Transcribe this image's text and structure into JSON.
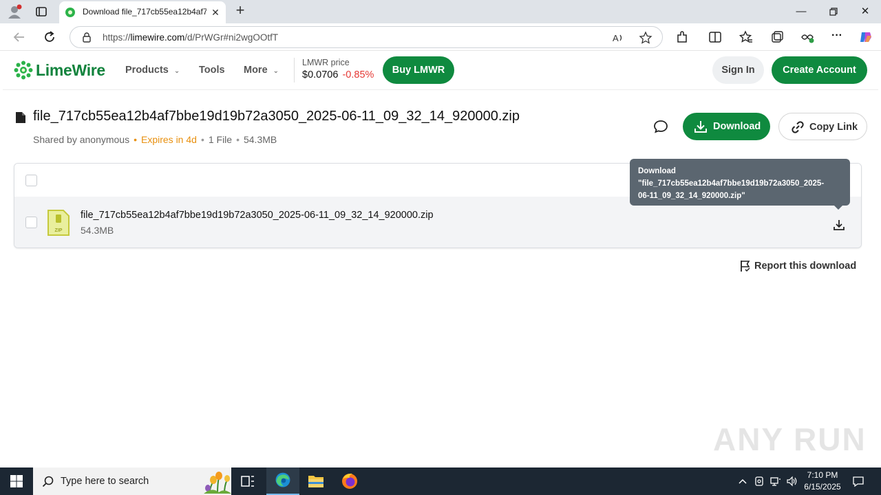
{
  "browser": {
    "tab_title": "Download file_717cb55ea12b4af7",
    "url_prefix": "https://",
    "url_host": "limewire.com",
    "url_path": "/d/PrWGr#ni2wgOOtfT"
  },
  "header": {
    "logo_text": "LimeWire",
    "nav": [
      "Products",
      "Tools",
      "More"
    ],
    "price_label": "LMWR price",
    "price_value": "$0.0706",
    "price_change": "-0.85%",
    "buy_label": "Buy LMWR",
    "signin_label": "Sign In",
    "create_label": "Create Account"
  },
  "file": {
    "title": "file_717cb55ea12b4af7bbe19d19b72a3050_2025-06-11_09_32_14_920000.zip",
    "shared_by": "Shared by anonymous",
    "expires": "Expires in 4d",
    "count": "1 File",
    "size": "54.3MB",
    "download_label": "Download",
    "copy_label": "Copy Link"
  },
  "list": {
    "row_name": "file_717cb55ea12b4af7bbe19d19b72a3050_2025-06-11_09_32_14_920000.zip",
    "row_size": "54.3MB"
  },
  "tooltip": {
    "line1": "Download",
    "line2": "\"file_717cb55ea12b4af7bbe19d19b72a3050_2025-",
    "line3": "06-11_09_32_14_920000.zip\""
  },
  "report_label": "Report this download",
  "watermark": "ANY RUN",
  "taskbar": {
    "search_placeholder": "Type here to search",
    "time": "7:10 PM",
    "date": "6/15/2025"
  },
  "colors": {
    "brand_green": "#0f8a3f",
    "price_down": "#e53935",
    "expires_orange": "#e8900f"
  }
}
